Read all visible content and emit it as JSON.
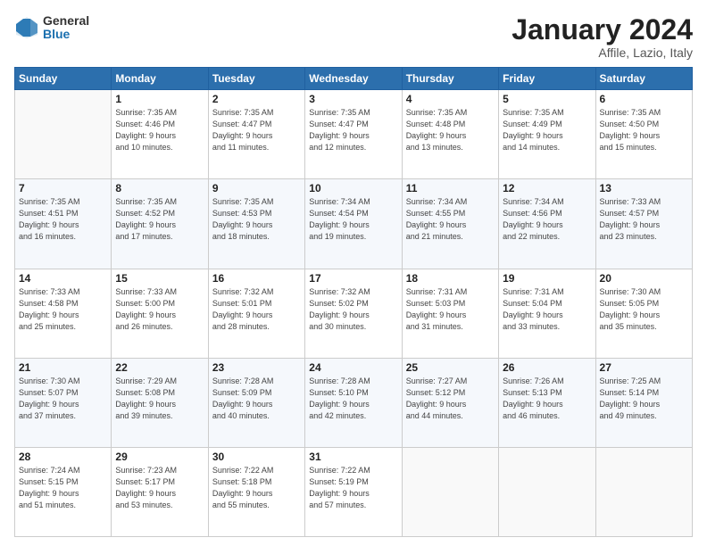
{
  "logo": {
    "general": "General",
    "blue": "Blue"
  },
  "title": {
    "month": "January 2024",
    "location": "Affile, Lazio, Italy"
  },
  "headers": [
    "Sunday",
    "Monday",
    "Tuesday",
    "Wednesday",
    "Thursday",
    "Friday",
    "Saturday"
  ],
  "weeks": [
    [
      {
        "day": "",
        "info": ""
      },
      {
        "day": "1",
        "info": "Sunrise: 7:35 AM\nSunset: 4:46 PM\nDaylight: 9 hours\nand 10 minutes."
      },
      {
        "day": "2",
        "info": "Sunrise: 7:35 AM\nSunset: 4:47 PM\nDaylight: 9 hours\nand 11 minutes."
      },
      {
        "day": "3",
        "info": "Sunrise: 7:35 AM\nSunset: 4:47 PM\nDaylight: 9 hours\nand 12 minutes."
      },
      {
        "day": "4",
        "info": "Sunrise: 7:35 AM\nSunset: 4:48 PM\nDaylight: 9 hours\nand 13 minutes."
      },
      {
        "day": "5",
        "info": "Sunrise: 7:35 AM\nSunset: 4:49 PM\nDaylight: 9 hours\nand 14 minutes."
      },
      {
        "day": "6",
        "info": "Sunrise: 7:35 AM\nSunset: 4:50 PM\nDaylight: 9 hours\nand 15 minutes."
      }
    ],
    [
      {
        "day": "7",
        "info": "Sunrise: 7:35 AM\nSunset: 4:51 PM\nDaylight: 9 hours\nand 16 minutes."
      },
      {
        "day": "8",
        "info": "Sunrise: 7:35 AM\nSunset: 4:52 PM\nDaylight: 9 hours\nand 17 minutes."
      },
      {
        "day": "9",
        "info": "Sunrise: 7:35 AM\nSunset: 4:53 PM\nDaylight: 9 hours\nand 18 minutes."
      },
      {
        "day": "10",
        "info": "Sunrise: 7:34 AM\nSunset: 4:54 PM\nDaylight: 9 hours\nand 19 minutes."
      },
      {
        "day": "11",
        "info": "Sunrise: 7:34 AM\nSunset: 4:55 PM\nDaylight: 9 hours\nand 21 minutes."
      },
      {
        "day": "12",
        "info": "Sunrise: 7:34 AM\nSunset: 4:56 PM\nDaylight: 9 hours\nand 22 minutes."
      },
      {
        "day": "13",
        "info": "Sunrise: 7:33 AM\nSunset: 4:57 PM\nDaylight: 9 hours\nand 23 minutes."
      }
    ],
    [
      {
        "day": "14",
        "info": "Sunrise: 7:33 AM\nSunset: 4:58 PM\nDaylight: 9 hours\nand 25 minutes."
      },
      {
        "day": "15",
        "info": "Sunrise: 7:33 AM\nSunset: 5:00 PM\nDaylight: 9 hours\nand 26 minutes."
      },
      {
        "day": "16",
        "info": "Sunrise: 7:32 AM\nSunset: 5:01 PM\nDaylight: 9 hours\nand 28 minutes."
      },
      {
        "day": "17",
        "info": "Sunrise: 7:32 AM\nSunset: 5:02 PM\nDaylight: 9 hours\nand 30 minutes."
      },
      {
        "day": "18",
        "info": "Sunrise: 7:31 AM\nSunset: 5:03 PM\nDaylight: 9 hours\nand 31 minutes."
      },
      {
        "day": "19",
        "info": "Sunrise: 7:31 AM\nSunset: 5:04 PM\nDaylight: 9 hours\nand 33 minutes."
      },
      {
        "day": "20",
        "info": "Sunrise: 7:30 AM\nSunset: 5:05 PM\nDaylight: 9 hours\nand 35 minutes."
      }
    ],
    [
      {
        "day": "21",
        "info": "Sunrise: 7:30 AM\nSunset: 5:07 PM\nDaylight: 9 hours\nand 37 minutes."
      },
      {
        "day": "22",
        "info": "Sunrise: 7:29 AM\nSunset: 5:08 PM\nDaylight: 9 hours\nand 39 minutes."
      },
      {
        "day": "23",
        "info": "Sunrise: 7:28 AM\nSunset: 5:09 PM\nDaylight: 9 hours\nand 40 minutes."
      },
      {
        "day": "24",
        "info": "Sunrise: 7:28 AM\nSunset: 5:10 PM\nDaylight: 9 hours\nand 42 minutes."
      },
      {
        "day": "25",
        "info": "Sunrise: 7:27 AM\nSunset: 5:12 PM\nDaylight: 9 hours\nand 44 minutes."
      },
      {
        "day": "26",
        "info": "Sunrise: 7:26 AM\nSunset: 5:13 PM\nDaylight: 9 hours\nand 46 minutes."
      },
      {
        "day": "27",
        "info": "Sunrise: 7:25 AM\nSunset: 5:14 PM\nDaylight: 9 hours\nand 49 minutes."
      }
    ],
    [
      {
        "day": "28",
        "info": "Sunrise: 7:24 AM\nSunset: 5:15 PM\nDaylight: 9 hours\nand 51 minutes."
      },
      {
        "day": "29",
        "info": "Sunrise: 7:23 AM\nSunset: 5:17 PM\nDaylight: 9 hours\nand 53 minutes."
      },
      {
        "day": "30",
        "info": "Sunrise: 7:22 AM\nSunset: 5:18 PM\nDaylight: 9 hours\nand 55 minutes."
      },
      {
        "day": "31",
        "info": "Sunrise: 7:22 AM\nSunset: 5:19 PM\nDaylight: 9 hours\nand 57 minutes."
      },
      {
        "day": "",
        "info": ""
      },
      {
        "day": "",
        "info": ""
      },
      {
        "day": "",
        "info": ""
      }
    ]
  ]
}
